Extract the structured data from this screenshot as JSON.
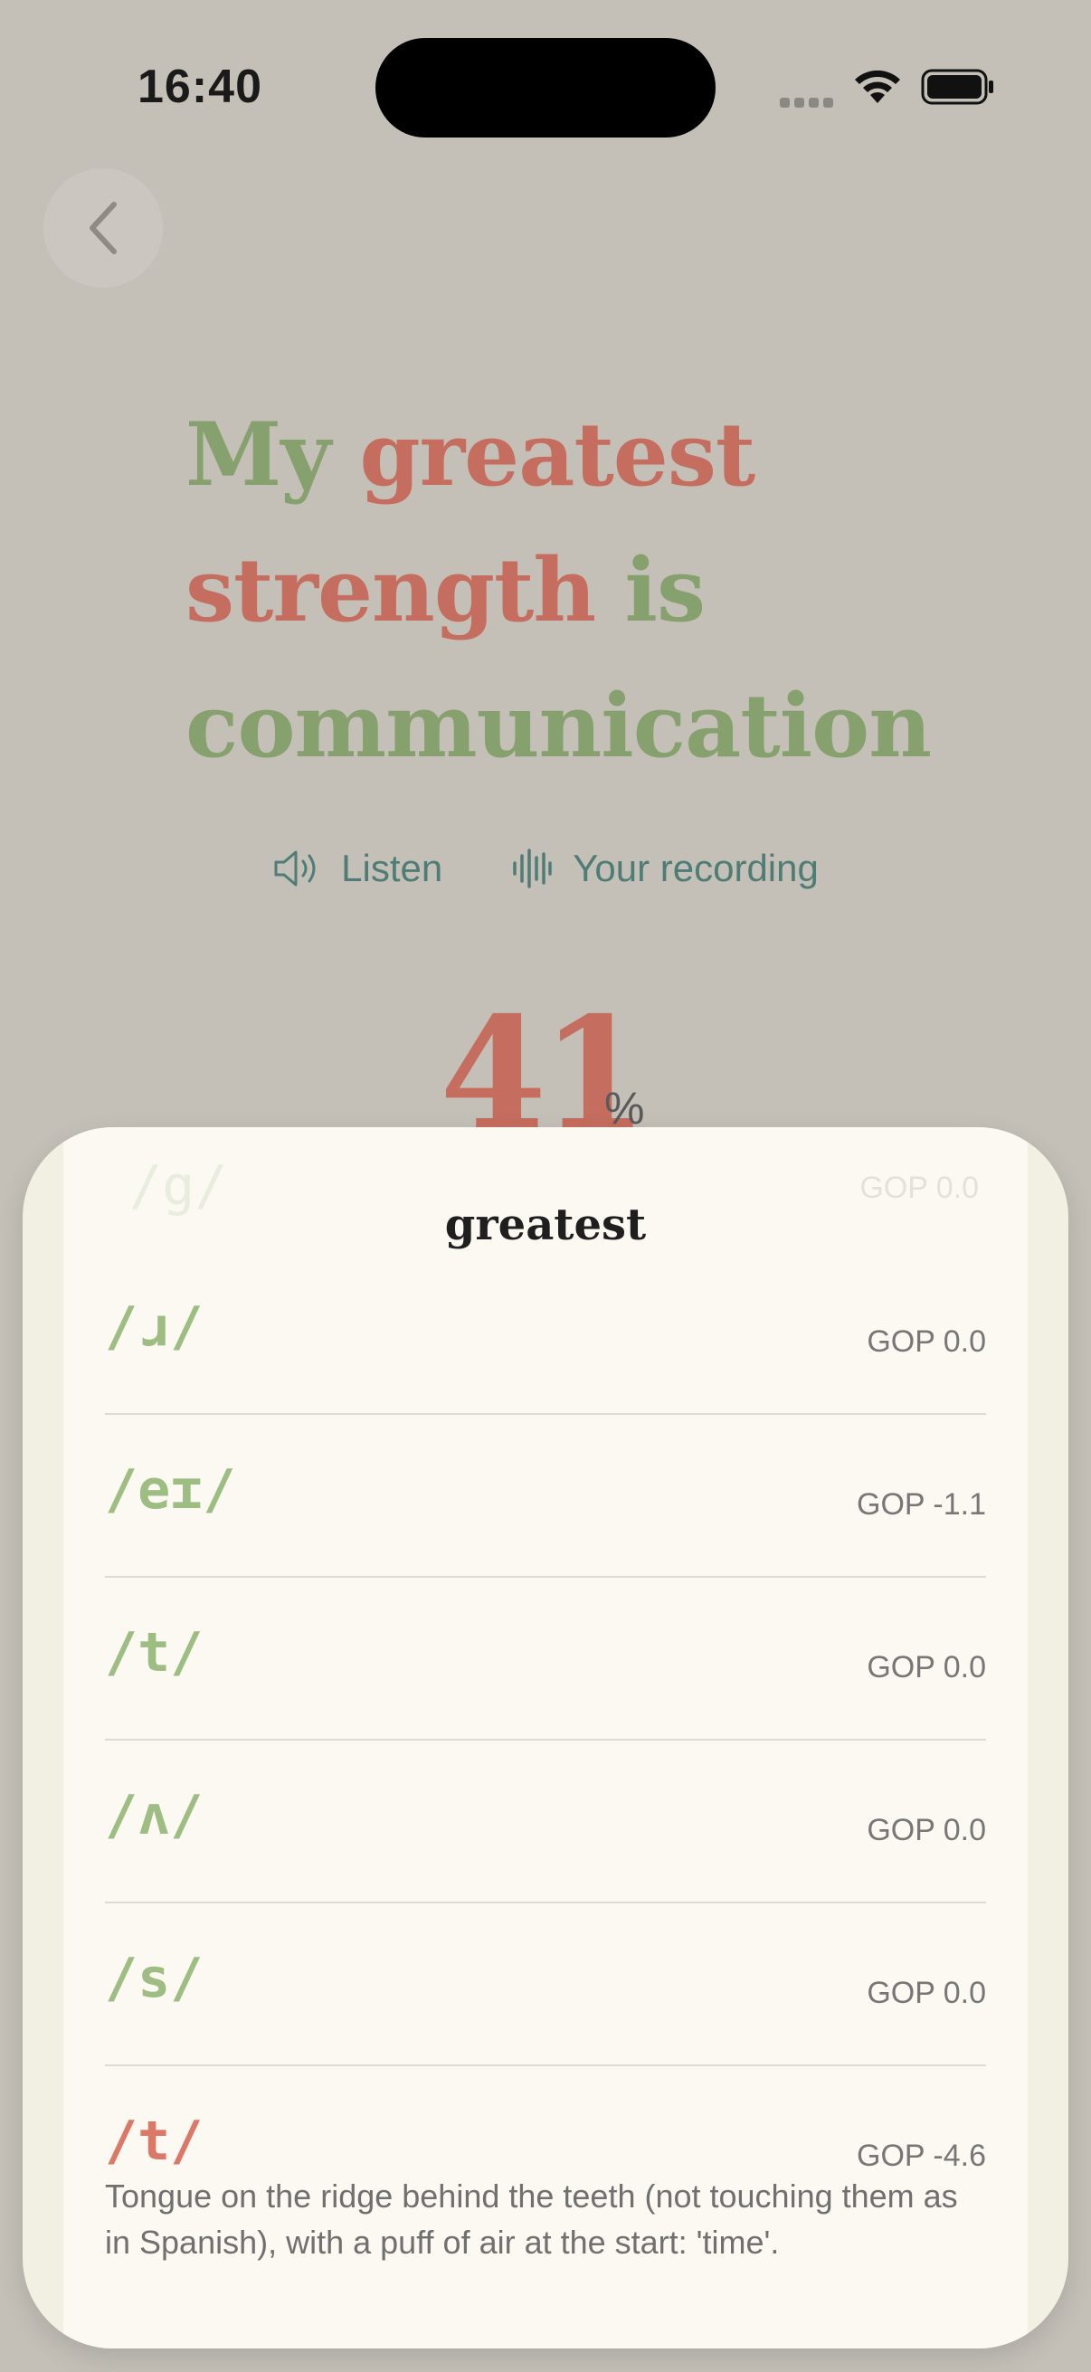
{
  "status": {
    "time": "16:40"
  },
  "sentence": [
    {
      "text": "My",
      "quality": "good"
    },
    {
      "text": "greatest",
      "quality": "bad"
    },
    {
      "text": "strength",
      "quality": "bad"
    },
    {
      "text": "is",
      "quality": "good"
    },
    {
      "text": "communication",
      "quality": "good"
    }
  ],
  "audio": {
    "listen_label": "Listen",
    "recording_label": "Your recording"
  },
  "score": {
    "value": "41",
    "unit": "%"
  },
  "sheet": {
    "title": "greatest",
    "ghost_row": {
      "phoneme": "/g/",
      "gop": "GOP 0.0"
    },
    "phonemes": [
      {
        "phoneme": "/ɹ/",
        "gop": "GOP 0.0",
        "quality": "good"
      },
      {
        "phoneme": "/eɪ/",
        "gop": "GOP -1.1",
        "quality": "good"
      },
      {
        "phoneme": "/t/",
        "gop": "GOP 0.0",
        "quality": "good"
      },
      {
        "phoneme": "/ʌ/",
        "gop": "GOP 0.0",
        "quality": "good"
      },
      {
        "phoneme": "/s/",
        "gop": "GOP 0.0",
        "quality": "good"
      },
      {
        "phoneme": "/t/",
        "gop": "GOP -4.6",
        "quality": "bad",
        "tip": "Tongue on the ridge behind the teeth (not touching them as in Spanish), with a puff of air at the start: 'time'."
      }
    ]
  },
  "colors": {
    "good": "#86a06e",
    "bad": "#c56d5e",
    "accent": "#4f7d76",
    "background": "#c4c0b8",
    "sheet": "#fbf9f2"
  },
  "icons": [
    "chevron-left-icon",
    "speaker-icon",
    "waveform-icon",
    "wifi-icon",
    "battery-icon"
  ]
}
